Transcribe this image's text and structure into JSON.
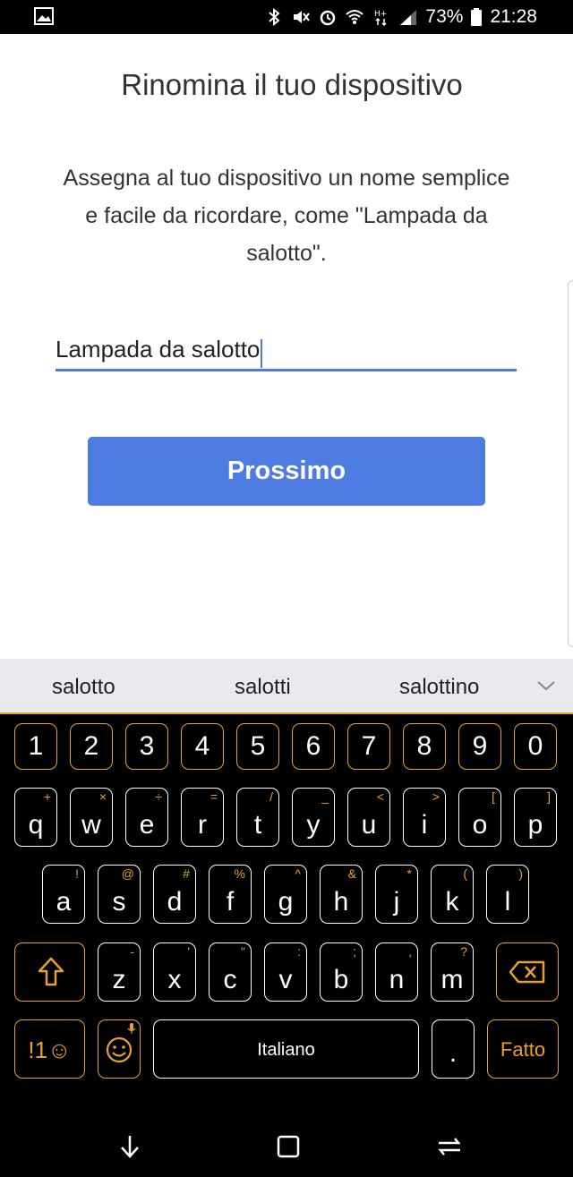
{
  "status": {
    "battery": "73%",
    "time": "21:28"
  },
  "screen": {
    "title": "Rinomina il tuo dispositivo",
    "description": "Assegna al tuo dispositivo un nome semplice e facile da ricordare, come \"Lampada da salotto\".",
    "input_value": "Lampada da salotto",
    "next_label": "Prossimo"
  },
  "suggestions": [
    "salotto",
    "salotti",
    "salottino"
  ],
  "keyboard": {
    "numbers": [
      "1",
      "2",
      "3",
      "4",
      "5",
      "6",
      "7",
      "8",
      "9",
      "0"
    ],
    "row1": [
      {
        "k": "q",
        "a": "+"
      },
      {
        "k": "w",
        "a": "×"
      },
      {
        "k": "e",
        "a": "÷"
      },
      {
        "k": "r",
        "a": "="
      },
      {
        "k": "t",
        "a": "/"
      },
      {
        "k": "y",
        "a": "_"
      },
      {
        "k": "u",
        "a": "<"
      },
      {
        "k": "i",
        "a": ">"
      },
      {
        "k": "o",
        "a": "["
      },
      {
        "k": "p",
        "a": "]"
      }
    ],
    "row2": [
      {
        "k": "a",
        "a": "!"
      },
      {
        "k": "s",
        "a": "@"
      },
      {
        "k": "d",
        "a": "#"
      },
      {
        "k": "f",
        "a": "%"
      },
      {
        "k": "g",
        "a": "^"
      },
      {
        "k": "h",
        "a": "&"
      },
      {
        "k": "j",
        "a": "*"
      },
      {
        "k": "k",
        "a": "("
      },
      {
        "k": "l",
        "a": ")"
      }
    ],
    "row3": [
      {
        "k": "z",
        "a": "-"
      },
      {
        "k": "x",
        "a": "'"
      },
      {
        "k": "c",
        "a": "\""
      },
      {
        "k": "v",
        "a": ":"
      },
      {
        "k": "b",
        "a": ";"
      },
      {
        "k": "n",
        "a": ","
      },
      {
        "k": "m",
        "a": "?"
      }
    ],
    "symbols_label": "!1☺",
    "space_label": "Italiano",
    "period_label": ".",
    "done_label": "Fatto"
  }
}
